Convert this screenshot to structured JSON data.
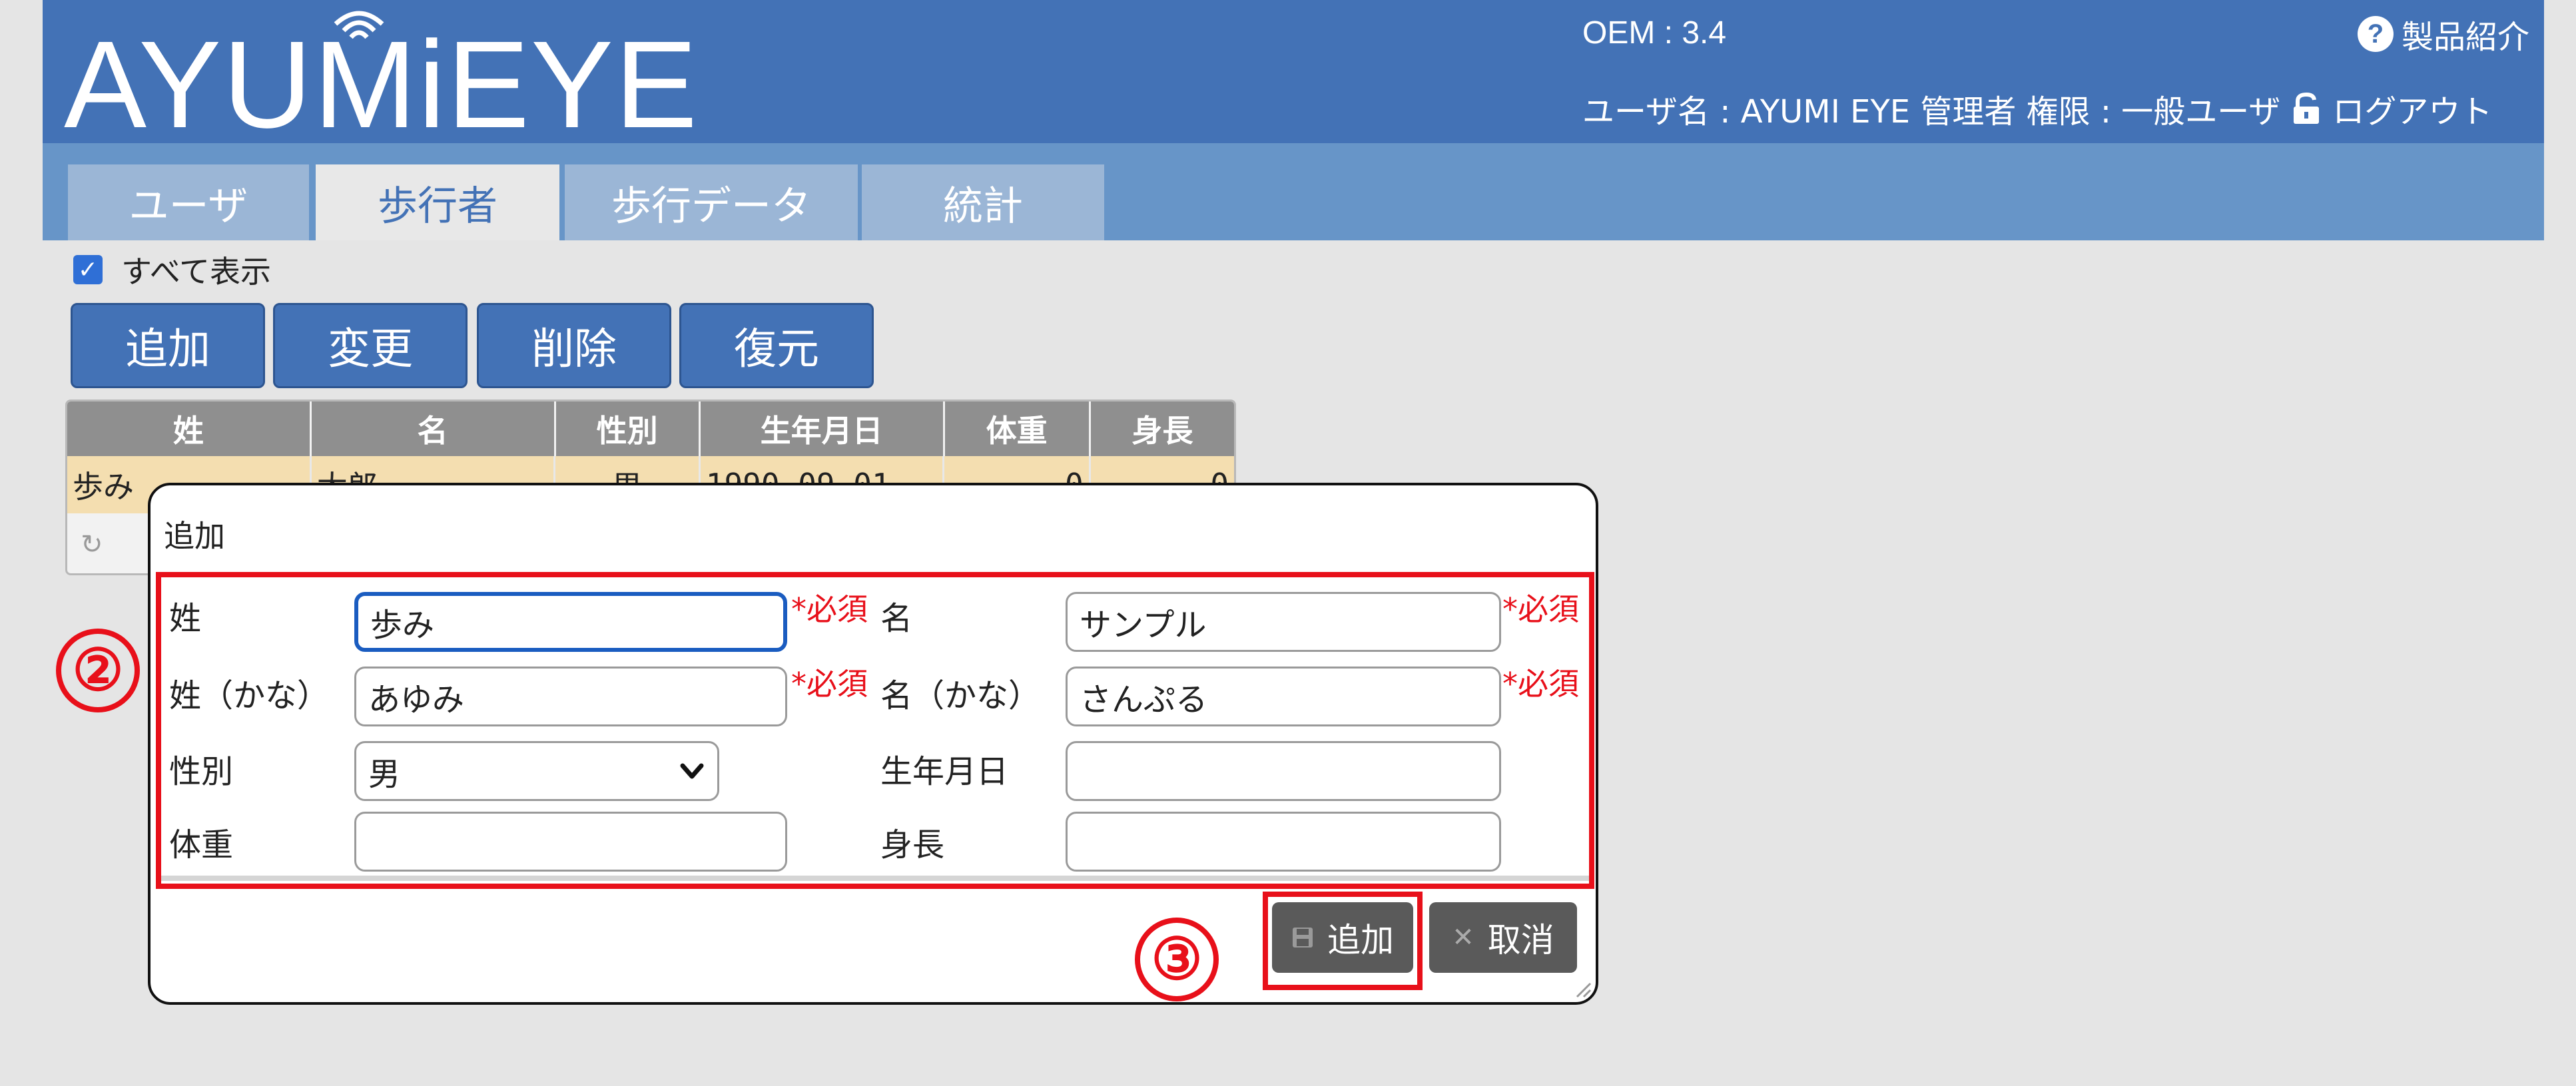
{
  "header": {
    "logo_text": "AYUMiEYE",
    "oem": "OEM : 3.4",
    "product_link": "製品紹介",
    "user_info": "ユーザ名 : AYUMI EYE 管理者 権限 : 一般ユーザ",
    "logout": "ログアウト",
    "colors": {
      "header_bg": "#4372b6",
      "tabbar_bg": "#6795c8"
    }
  },
  "tabs": [
    {
      "label": "ユーザ",
      "active": false
    },
    {
      "label": "歩行者",
      "active": true
    },
    {
      "label": "歩行データ",
      "active": false
    },
    {
      "label": "統計",
      "active": false
    }
  ],
  "toolbar": {
    "show_all_label": "すべて表示",
    "show_all_checked": true,
    "buttons": [
      "追加",
      "変更",
      "削除",
      "復元"
    ]
  },
  "grid": {
    "columns": [
      "姓",
      "名",
      "性別",
      "生年月日",
      "体重",
      "身長"
    ],
    "rows": [
      [
        "歩み",
        "太郎",
        "男",
        "1990-09-01",
        "0",
        "0"
      ]
    ]
  },
  "dialog": {
    "title": "追加",
    "required_mark": "*必須",
    "fields": {
      "last_name": {
        "label": "姓",
        "value": "歩み"
      },
      "first_name": {
        "label": "名",
        "value": "サンプル"
      },
      "last_name_kana": {
        "label": "姓（かな）",
        "value": "あゆみ"
      },
      "first_name_kana": {
        "label": "名（かな）",
        "value": "さんぷる"
      },
      "gender": {
        "label": "性別",
        "value": "男"
      },
      "birthdate": {
        "label": "生年月日",
        "value": ""
      },
      "weight": {
        "label": "体重",
        "value": ""
      },
      "height": {
        "label": "身長",
        "value": ""
      }
    },
    "add_button": "追加",
    "cancel_button": "取消"
  },
  "annotations": {
    "step2": "②",
    "step3": "③",
    "highlight_color": "#e8101a"
  }
}
